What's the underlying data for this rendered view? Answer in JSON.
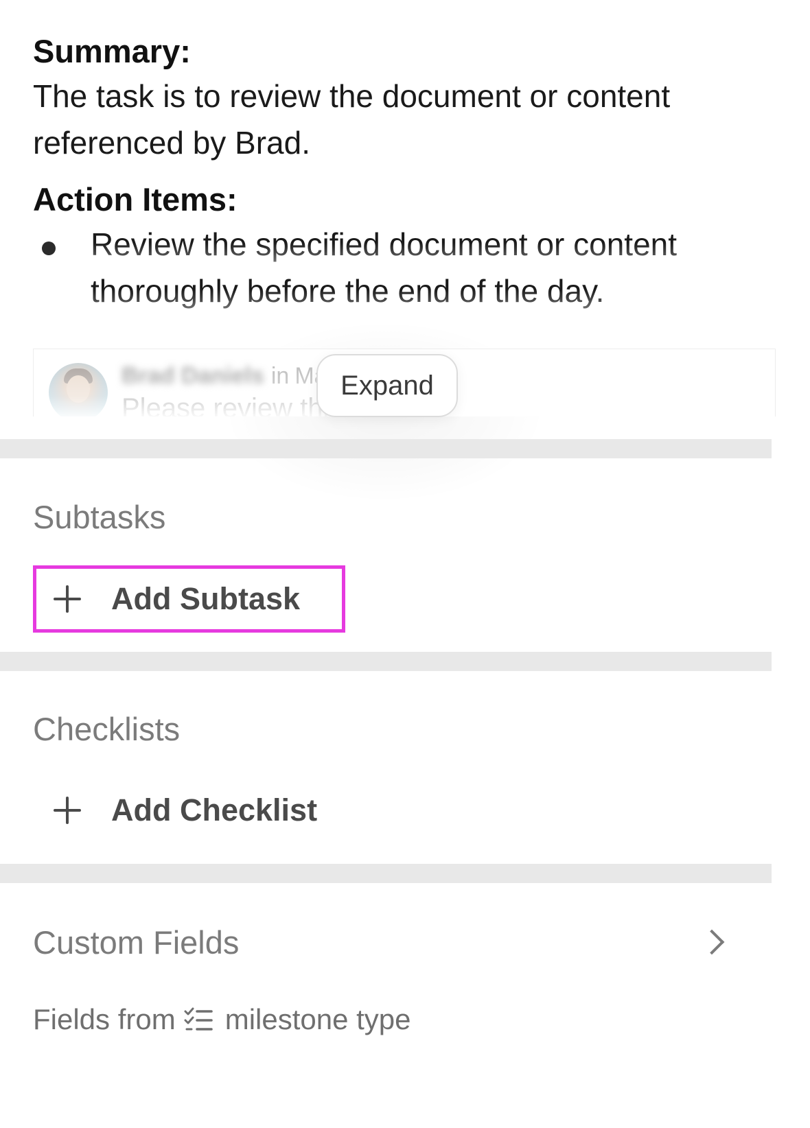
{
  "description": {
    "summary_heading": "Summary:",
    "summary_text": "The task is to review the document or content referenced by Brad.",
    "action_items_heading": "Action Items:",
    "action_items": [
      "Review the specified document or content thoroughly before the end of the day."
    ]
  },
  "quoted_message": {
    "author": "Brad Daniels",
    "channel_prefix": "in",
    "channel": "Marketing",
    "text": "Please review this EOD",
    "expand_label": "Expand"
  },
  "subtasks": {
    "title": "Subtasks",
    "add_label": "Add Subtask"
  },
  "checklists": {
    "title": "Checklists",
    "add_label": "Add Checklist"
  },
  "custom_fields": {
    "title": "Custom Fields",
    "fields_from_prefix": "Fields from",
    "fields_from_type": "milestone type"
  },
  "colors": {
    "highlight": "#e63adf",
    "separator": "#e8e8e8",
    "section_title": "#7b7b7b"
  },
  "icons": {
    "add": "plus-icon",
    "custom_fields_nav": "chevron-right-icon",
    "milestone": "milestone-list-icon"
  }
}
